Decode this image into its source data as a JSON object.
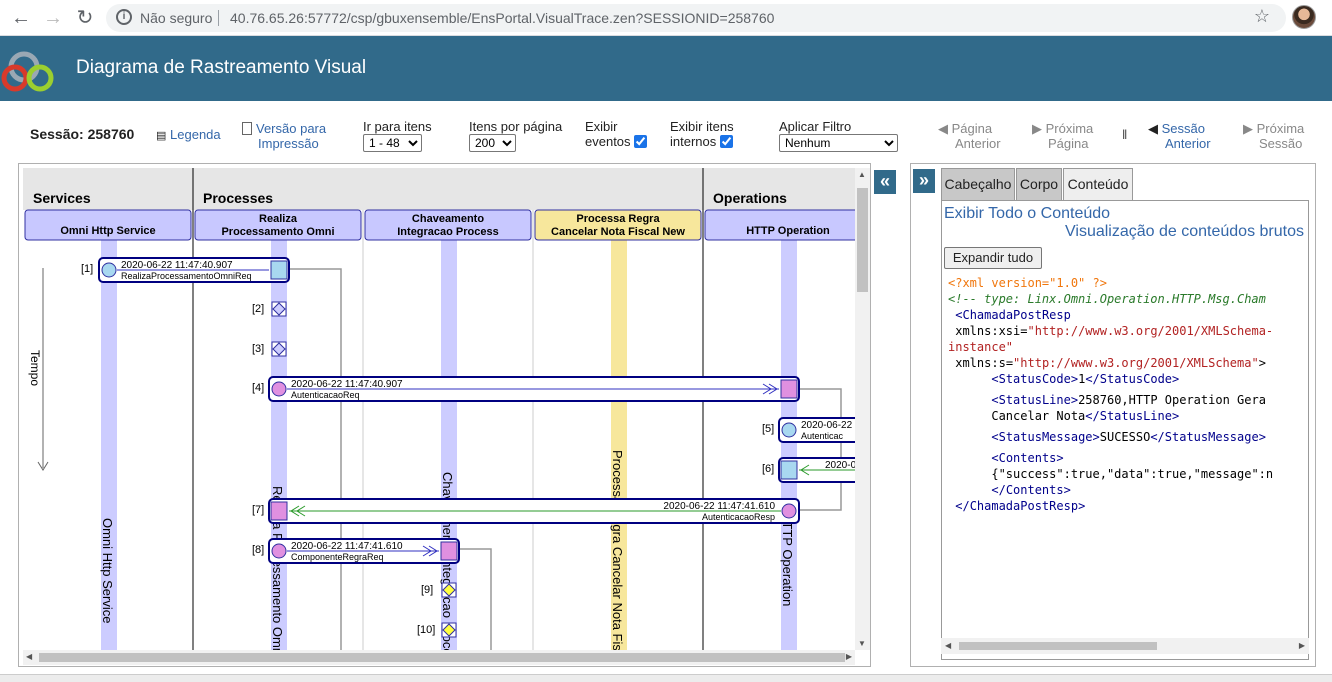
{
  "browser": {
    "security_label": "Não seguro",
    "url": "40.76.65.26:57772/csp/gbuxensemble/EnsPortal.VisualTrace.zen?SESSIONID=258760"
  },
  "app": {
    "title": "Diagrama de Rastreamento Visual"
  },
  "toolbar": {
    "session_label": "Sessão: 258760",
    "legend": "Legenda",
    "print_version": [
      "Versão para",
      "Impressão"
    ],
    "goto_label": "Ir para itens",
    "goto_value": "1 - 48",
    "per_page_label": "Itens por página",
    "per_page_value": "200",
    "show_events": [
      "Exibir",
      "eventos"
    ],
    "show_internal": [
      "Exibir itens",
      "internos"
    ],
    "filter_label": "Aplicar Filtro",
    "filter_value": "Nenhum",
    "prev_page": [
      "Página",
      "Anterior"
    ],
    "next_page": [
      "Próxima",
      "Página"
    ],
    "prev_session": [
      "Sessão",
      "Anterior"
    ],
    "next_session": [
      "Próxima",
      "Sessão"
    ]
  },
  "diagram": {
    "sections": [
      "Services",
      "Processes",
      "Operations"
    ],
    "hosts": [
      {
        "name": "Omni Http Service",
        "vertical": "Omni Http Service"
      },
      {
        "name": "Realiza\nProcessamento Omni",
        "vertical": "Realiza Processamento Omni"
      },
      {
        "name": "Chaveamento\nIntegracao Process",
        "vertical": "Chaveamento Integracao Process"
      },
      {
        "name": "Processa Regra\nCancelar Nota Fiscal New",
        "vertical": "Processa Regra Cancelar Nota Fiscal New"
      },
      {
        "name": "HTTP Operation",
        "vertical": "HTTP Operation"
      }
    ],
    "time_label": "Tempo",
    "messages": [
      {
        "idx": "[1]",
        "time": "2020-06-22 11:47:40.907",
        "name": "RealizaProcessamentoOmniReq"
      },
      {
        "idx": "[2]"
      },
      {
        "idx": "[3]"
      },
      {
        "idx": "[4]",
        "time": "2020-06-22 11:47:40.907",
        "name": "AutenticacaoReq"
      },
      {
        "idx": "[5]",
        "time": "2020-06-22",
        "name": "Autenticac"
      },
      {
        "idx": "[6]",
        "time": "2020-0"
      },
      {
        "idx": "[7]",
        "time": "2020-06-22 11:47:41.610",
        "name": "AutenticacaoResp"
      },
      {
        "idx": "[8]",
        "time": "2020-06-22 11:47:41.610",
        "name": "ComponenteRegraReq"
      },
      {
        "idx": "[9]"
      },
      {
        "idx": "[10]"
      }
    ]
  },
  "details": {
    "tabs": [
      "Cabeçalho",
      "Corpo",
      "Conteúdo"
    ],
    "active_tab": "Conteúdo",
    "show_all": "Exibir Todo o Conteúdo",
    "raw_view": "Visualização de conteúdos brutos",
    "expand_all": "Expandir tudo",
    "xml": {
      "pi": "<?xml version=\"1.0\" ?>",
      "comment": "<!-- type: Linx.Omni.Operation.HTTP.Msg.Cham",
      "root": "ChamadaPostResp",
      "xsi_attr": "xmlns:xsi",
      "xsi_val": "\"http://www.w3.org/2001/XMLSchema-",
      "xsi_val2": "instance\"",
      "s_attr": "xmlns:s",
      "s_val": "\"http://www.w3.org/2001/XMLSchema\"",
      "status_code_tag": "StatusCode",
      "status_code": "1",
      "status_line_tag": "StatusLine",
      "status_line_1": "258760,HTTP Operation Gera",
      "status_line_2": "Cancelar Nota",
      "status_message_tag": "StatusMessage",
      "status_message": "SUCESSO",
      "contents_tag": "Contents",
      "contents_value": "{\"success\":true,\"data\":true,\"message\":n"
    }
  }
}
